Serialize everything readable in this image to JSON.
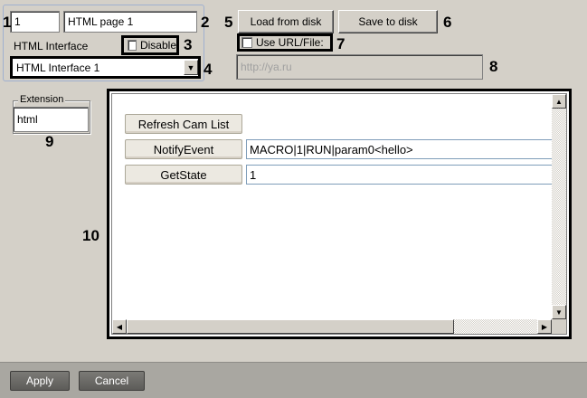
{
  "page": {
    "id_value": "1",
    "name_value": "HTML page 1",
    "html_interface_label": "HTML Interface",
    "disable_label": "Disable",
    "interface_select_value": "HTML Interface 1",
    "load_label": "Load from disk",
    "save_label": "Save to disk",
    "use_url_label": "Use URL/File:",
    "url_value": "http://ya.ru",
    "extension_label": "Extension",
    "extension_value": "html"
  },
  "browser": {
    "refresh_label": "Refresh Cam List",
    "notify_label": "NotifyEvent",
    "notify_value": "MACRO|1|RUN|param0<hello>",
    "getstate_label": "GetState",
    "getstate_value": "1"
  },
  "footer": {
    "apply_label": "Apply",
    "cancel_label": "Cancel"
  },
  "callouts": [
    "1",
    "2",
    "3",
    "4",
    "5",
    "6",
    "7",
    "8",
    "9",
    "10"
  ],
  "colors": {
    "background": "#d4d0c8",
    "panel_border": "#9fb0d0",
    "footer": "#a9a7a1",
    "highlight": "#000000"
  }
}
